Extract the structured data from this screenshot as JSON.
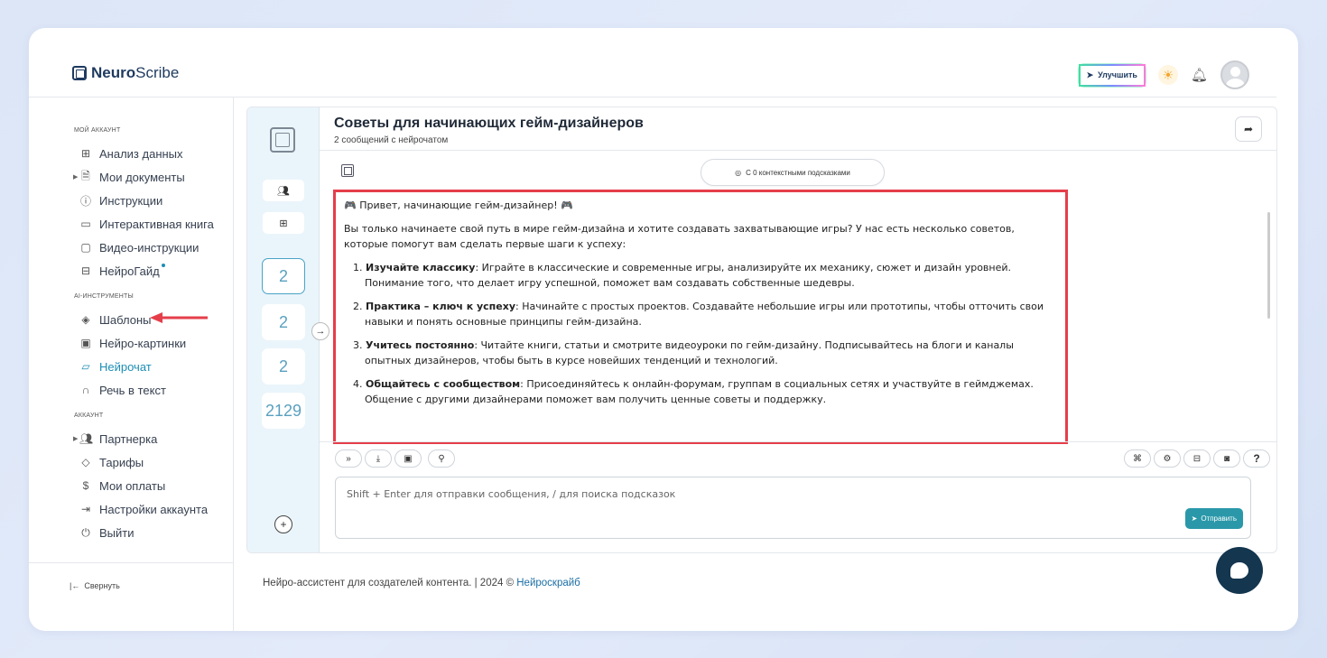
{
  "header": {
    "logo_bold": "Neuro",
    "logo_rest": "Scribe",
    "upgrade_label": "Улучшить"
  },
  "sidebar": {
    "section_account": "МОЙ АККАУНТ",
    "account_items": [
      {
        "label": "Анализ данных",
        "icon": "grid-icon"
      },
      {
        "label": "Мои документы",
        "icon": "document-icon"
      },
      {
        "label": "Инструкции",
        "icon": "help-icon"
      },
      {
        "label": "Интерактивная книга",
        "icon": "book-icon"
      },
      {
        "label": "Видео-инструкции",
        "icon": "video-icon"
      },
      {
        "label": "НейроГайд",
        "icon": "guide-icon"
      }
    ],
    "section_ai": "AI-ИНСТРУМЕНТЫ",
    "ai_items": [
      {
        "label": "Шаблоны",
        "icon": "layers-icon"
      },
      {
        "label": "Нейро-картинки",
        "icon": "image-icon"
      },
      {
        "label": "Нейрочат",
        "icon": "chat-icon"
      },
      {
        "label": "Речь в текст",
        "icon": "headphones-icon"
      }
    ],
    "section_acc": "АККАУНТ",
    "acc_items": [
      {
        "label": "Партнерка",
        "icon": "users-icon"
      },
      {
        "label": "Тарифы",
        "icon": "tag-icon"
      },
      {
        "label": "Мои оплаты",
        "icon": "dollar-icon"
      },
      {
        "label": "Настройки аккаунта",
        "icon": "login-icon"
      },
      {
        "label": "Выйти",
        "icon": "power-icon"
      }
    ],
    "collapse_label": "Свернуть"
  },
  "rail": {
    "counts": [
      "2",
      "2",
      "2",
      "2129"
    ]
  },
  "chat": {
    "title": "Советы для начинающих гейм-дизайнеров",
    "subtitle": "2 сообщений с нейрочатом",
    "context_pill": "С 0 контекстными подсказками",
    "greeting": "🎮 Привет, начинающие гейм-дизайнер! 🎮",
    "intro": "Вы только начинаете свой путь в мире гейм-дизайна и хотите создавать захватывающие игры? У нас есть несколько советов, которые помогут вам сделать первые шаги к успеху:",
    "tips": [
      {
        "num": "1.",
        "title": "Изучайте классику",
        "text": ": Играйте в классические и современные игры, анализируйте их механику, сюжет и дизайн уровней. Понимание того, что делает игру успешной, поможет вам создавать собственные шедевры."
      },
      {
        "num": "2.",
        "title": "Практика – ключ к успеху",
        "text": ": Начинайте с простых проектов. Создавайте небольшие игры или прототипы, чтобы отточить свои навыки и понять основные принципы гейм-дизайна."
      },
      {
        "num": "3.",
        "title": "Учитесь постоянно",
        "text": ": Читайте книги, статьи и смотрите видеоуроки по гейм-дизайну. Подписывайтесь на блоги и каналы опытных дизайнеров, чтобы быть в курсе новейших тенденций и технологий."
      },
      {
        "num": "4.",
        "title": "Общайтесь с сообществом",
        "text": ": Присоединяйтесь к онлайн-форумам, группам в социальных сетях и участвуйте в геймджемах. Общение с другими дизайнерами поможет вам получить ценные советы и поддержку."
      }
    ],
    "input_placeholder": "Shift + Enter для отправки сообщения, / для поиска подсказок",
    "send_label": "Отправить",
    "help_label": "?"
  },
  "footer": {
    "text": "Нейро-ассистент для создателей контента.  | 2024 © ",
    "link": "Нейроскрайб"
  }
}
